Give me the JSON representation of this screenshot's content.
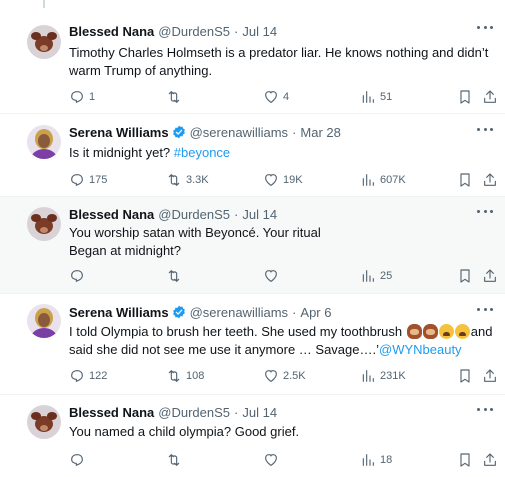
{
  "colors": {
    "accent": "#1d9bf0",
    "text": "#0f1419",
    "muted": "#536471",
    "verified": "#1d9bf0"
  },
  "icons": [
    "reply-icon",
    "retweet-icon",
    "like-icon",
    "views-icon",
    "bookmark-icon",
    "share-icon",
    "more-icon",
    "verified-icon"
  ],
  "tweets": [
    {
      "name": "Blessed Nana",
      "handle": "@DurdenS5",
      "time": "Jul 14",
      "text": "Timothy Charles Holmseth is a predator liar. He knows nothing and didn’t warm Trump of anything.",
      "replies": "1",
      "retweets": "",
      "likes": "4",
      "views": "51"
    },
    {
      "name": "Serena Williams",
      "handle": "@serenawilliams",
      "time": "Mar 28",
      "text_before": "Is it midnight yet? ",
      "hashtag": "#beyonce",
      "replies": "175",
      "retweets": "3.3K",
      "likes": "19K",
      "views": "607K"
    },
    {
      "name": "Blessed Nana",
      "handle": "@DurdenS5",
      "time": "Jul 14",
      "text": "You worship satan with Beyoncé. Your ritual\nBegan at midnight?",
      "replies": "",
      "retweets": "",
      "likes": "",
      "views": "25"
    },
    {
      "name": "Serena Williams",
      "handle": "@serenawilliams",
      "time": "Apr 6",
      "text_before": "I told Olympia to brush her teeth. She used my toothbrush ",
      "text_after": "and said she did not see me use it anymore … Savage….’",
      "mention": "@WYNbeauty",
      "replies": "122",
      "retweets": "108",
      "likes": "2.5K",
      "views": "231K"
    },
    {
      "name": "Blessed Nana",
      "handle": "@DurdenS5",
      "time": "Jul 14",
      "text": "You named a child olympia? Good grief.",
      "replies": "",
      "retweets": "",
      "likes": "",
      "views": "18"
    }
  ]
}
